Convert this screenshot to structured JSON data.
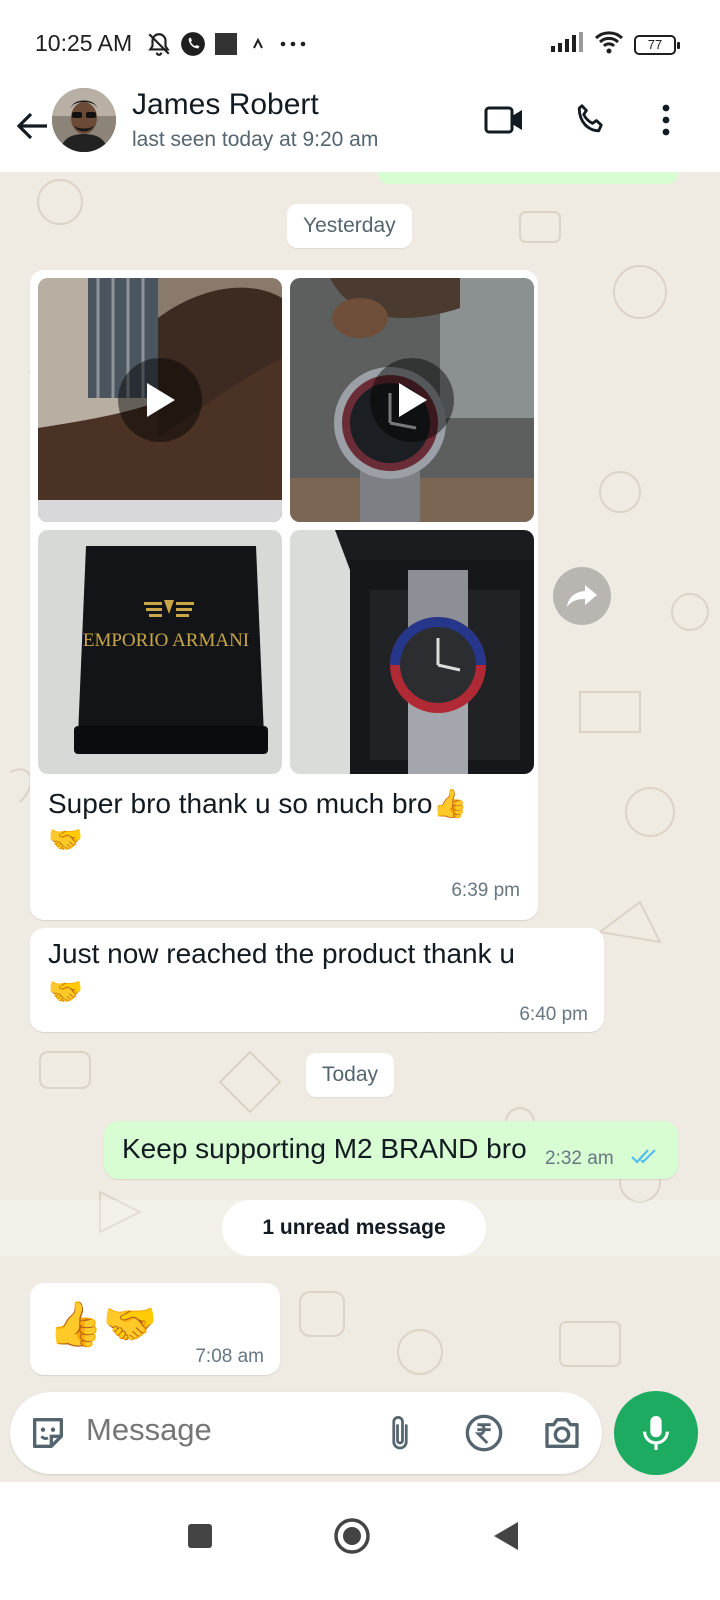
{
  "status_bar": {
    "time": "10:25 AM",
    "battery": "77"
  },
  "header": {
    "contact_name": "James Robert",
    "last_seen": "last seen today at 9:20 am",
    "icons": [
      "back-arrow-icon",
      "video-call-icon",
      "voice-call-icon",
      "more-options-icon"
    ]
  },
  "chat": {
    "day_yesterday": "Yesterday",
    "album": {
      "tiles": [
        {
          "kind": "video",
          "subject": "hand/wrist clip"
        },
        {
          "kind": "video",
          "subject": "watch in hand"
        },
        {
          "kind": "image",
          "subject": "black watch box",
          "box_text": "EMPORIO ARMANI"
        },
        {
          "kind": "image",
          "subject": "watch in open box"
        }
      ],
      "caption_line1": "Super bro  thank u so much  bro👍",
      "caption_line2": "🤝",
      "time": "6:39 pm"
    },
    "msg2": {
      "line1": "Just now reached  the product  thank u",
      "line2": "🤝",
      "time": "6:40 pm"
    },
    "day_today": "Today",
    "msg_out": {
      "text": "Keep supporting M2 BRAND bro",
      "time": "2:32 am",
      "ticks_color": "#53bdeb"
    },
    "unread_label": "1 unread message",
    "msg3": {
      "text": "👍🤝",
      "time": "7:08 am"
    }
  },
  "composer": {
    "placeholder": "Message",
    "icons": [
      "sticker-icon",
      "attach-icon",
      "payment-rupee-icon",
      "camera-icon",
      "mic-icon"
    ]
  },
  "colors": {
    "incoming_bubble": "#ffffff",
    "outgoing_bubble": "#d9fdd3",
    "chat_bg": "#efeae2",
    "accent": "#1daa61"
  }
}
